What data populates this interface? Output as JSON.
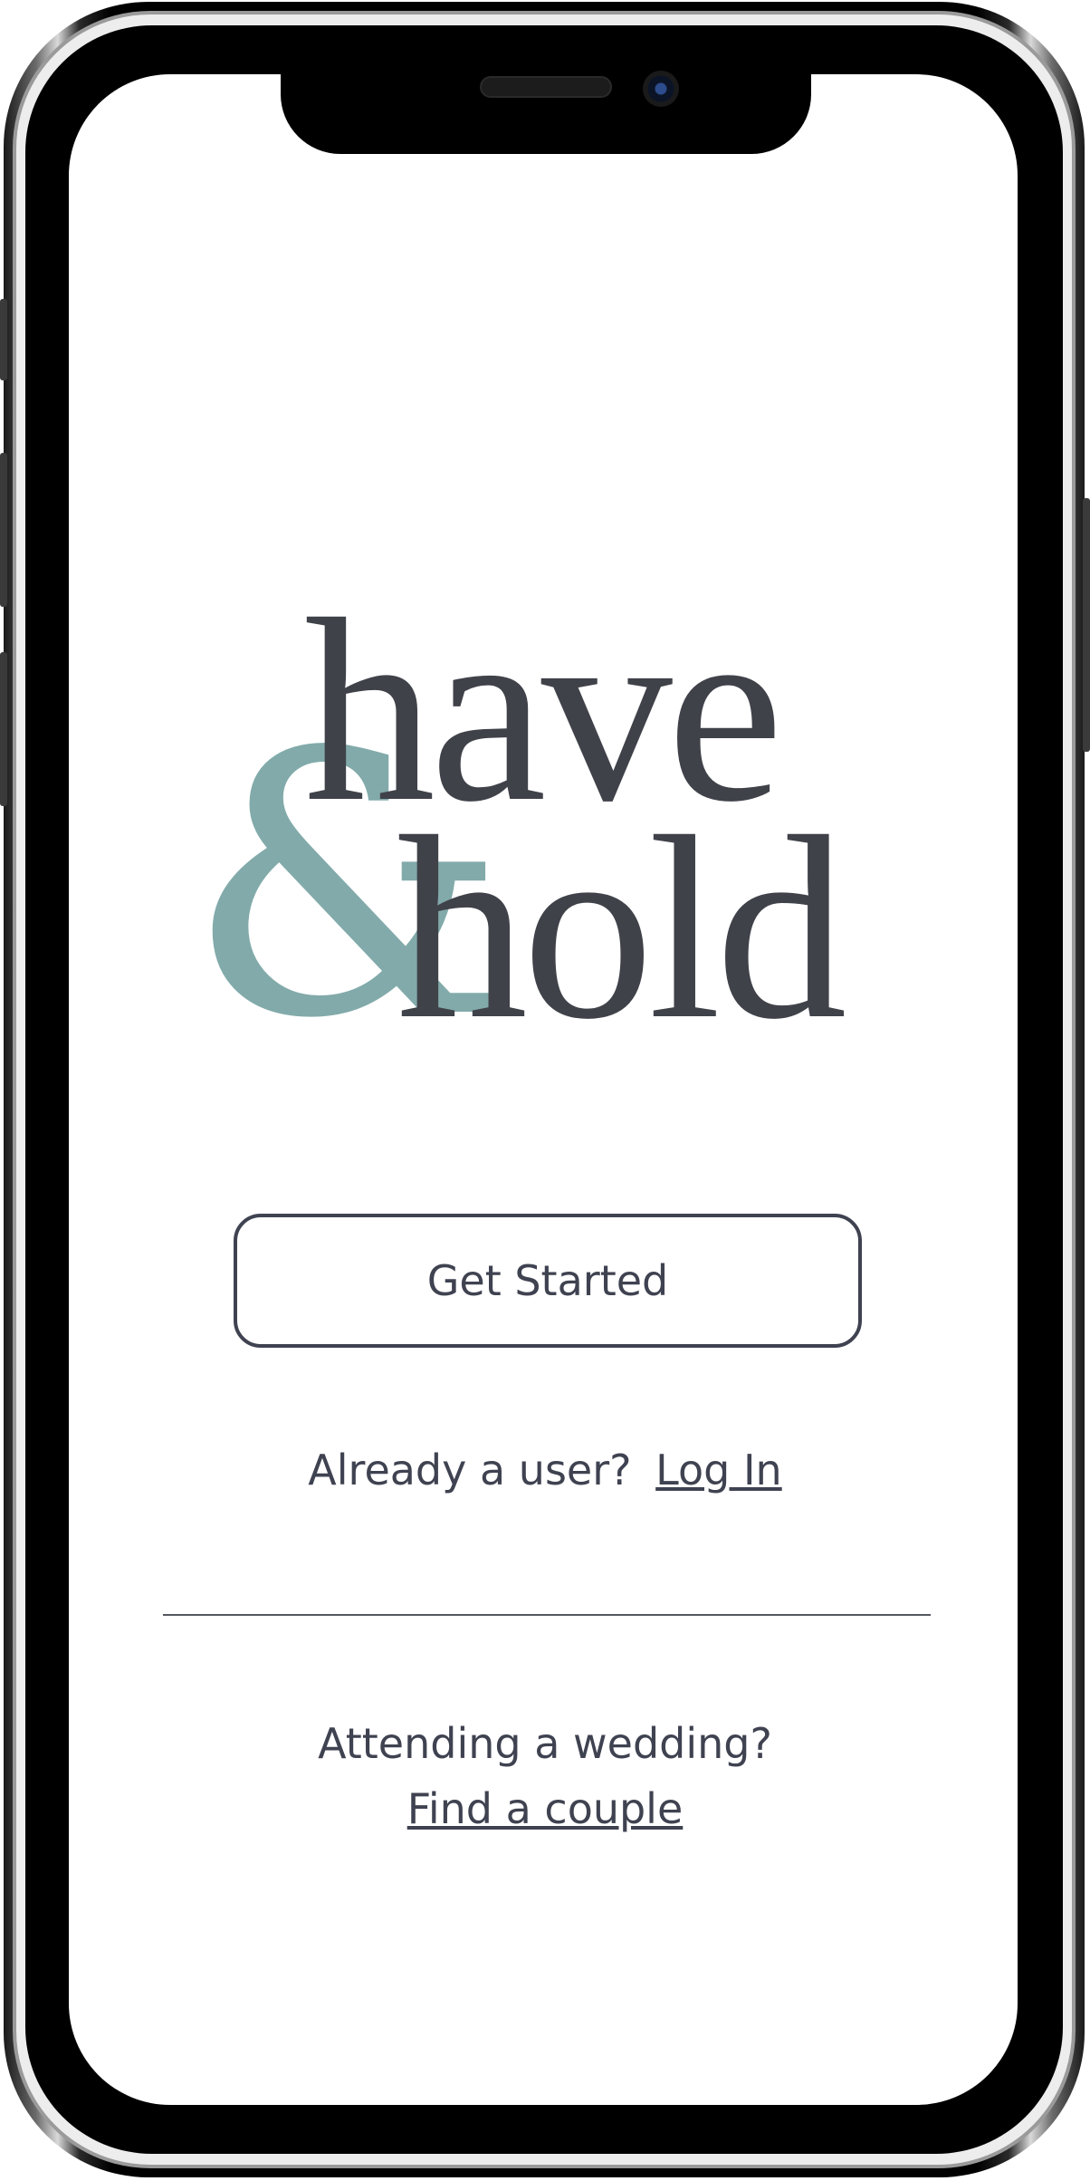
{
  "logo": {
    "word_top": "have",
    "ampersand": "&",
    "word_bottom": "hold",
    "colors": {
      "text": "#40424a",
      "ampersand": "#82aaaa"
    }
  },
  "actions": {
    "get_started_label": "Get Started"
  },
  "login": {
    "prompt": "Already a user?",
    "link_label": "Log In"
  },
  "guest": {
    "prompt": "Attending a wedding?",
    "link_label": "Find a couple"
  },
  "theme": {
    "primary_text": "#3f4250",
    "background": "#ffffff"
  }
}
